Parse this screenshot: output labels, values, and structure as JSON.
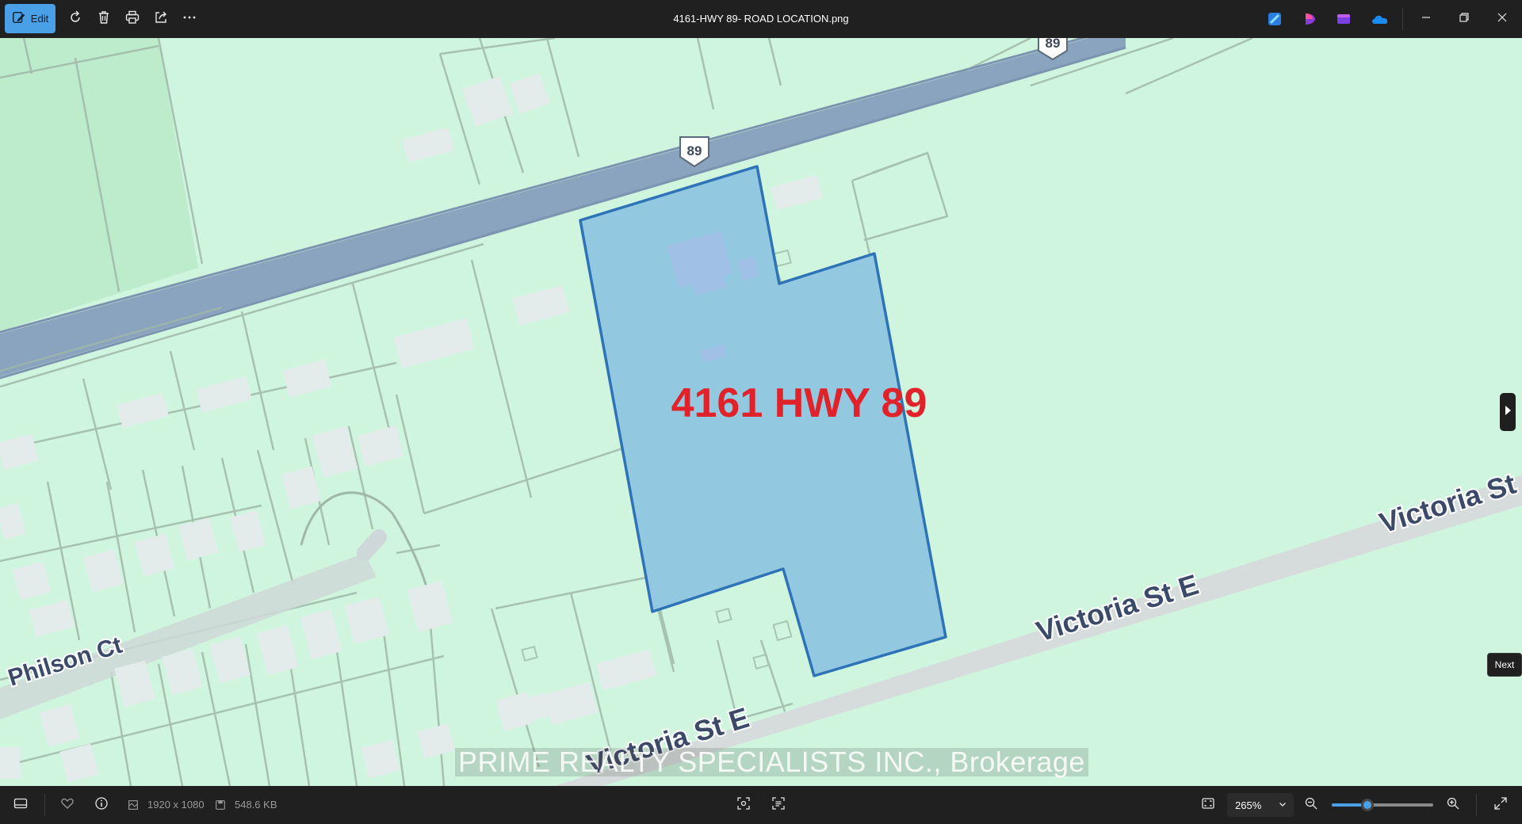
{
  "window": {
    "title": "4161-HWY 89- ROAD LOCATION.png"
  },
  "toolbar": {
    "edit_label": "Edit",
    "icons": [
      "edit-icon",
      "rotate-icon",
      "delete-icon",
      "print-icon",
      "share-icon",
      "more-icon"
    ]
  },
  "apps": [
    "designer-icon",
    "clipchamp-icon",
    "photos-icon",
    "onedrive-icon"
  ],
  "image": {
    "property_label": "4161 HWY 89",
    "streets": {
      "victoria_east": "Victoria St E",
      "victoria_west": "Victoria St E",
      "victoria_edge": "Victoria St",
      "philson": "Philson Ct"
    },
    "route_shield": "89",
    "route_shield_top": "89",
    "watermark": "PRIME REALTY SPECIALISTS INC., Brokerage",
    "colors": {
      "map_bg": "#cff5de",
      "highway": "#8aa3bf",
      "parcel": "#93c9e0",
      "parcel_border": "#2e73b8",
      "label": "#e0232b"
    }
  },
  "nav": {
    "next_tooltip": "Next"
  },
  "status": {
    "dimensions": "1920 x 1080",
    "file_size": "548.6 KB",
    "zoom": "265%",
    "zoom_level": 0.35
  }
}
